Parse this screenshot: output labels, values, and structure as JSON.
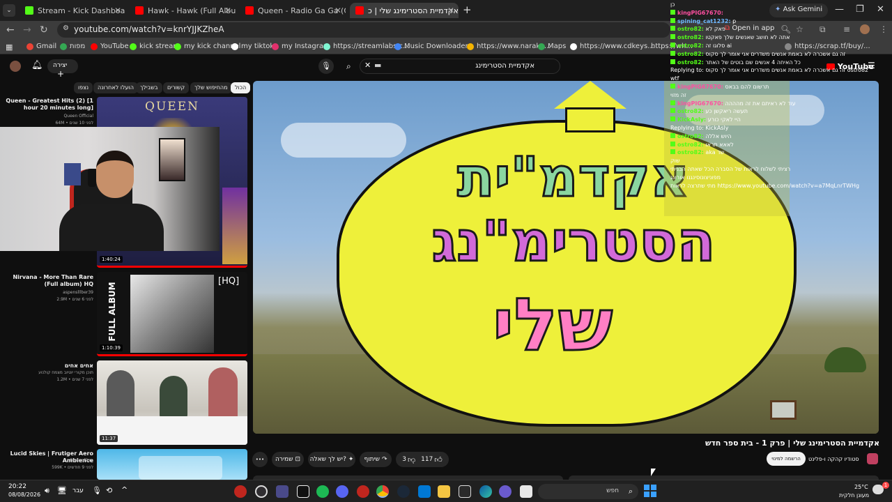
{
  "browser": {
    "tabs": [
      {
        "title": "Stream - Kick Dashboard",
        "color": "#53fc18"
      },
      {
        "title": "Hawk - Hawk (Full Album 1985)",
        "color": "#ff0000"
      },
      {
        "title": "Queen - Radio Ga Ga (Official V",
        "color": "#ff0000"
      },
      {
        "title": "אקדמיית הסטרימינג שלי | כ",
        "color": "#ff0000"
      }
    ],
    "new_tab": "+",
    "url": "youtube.com/watch?v=knrYJJKZheA",
    "ask_gemini": "Ask Gemini",
    "open_in_app": "Open in app",
    "bookmarks": [
      {
        "label": "Gmail",
        "color": "#ea4335"
      },
      {
        "label": "מפות",
        "color": "#34a853"
      },
      {
        "label": "YouTube",
        "color": "#ff0000"
      },
      {
        "label": "kick stream",
        "color": "#53fc18"
      },
      {
        "label": "my kick channel",
        "color": "#53fc18"
      },
      {
        "label": "my tiktok",
        "color": "#ffffff"
      },
      {
        "label": "my Instagram",
        "color": "#e1306c"
      },
      {
        "label": "https://streamlabs.c...",
        "color": "#80f5d2"
      },
      {
        "label": "Music Downloader...",
        "color": "#4285f4"
      },
      {
        "label": "https://www.narake...",
        "color": "#f4b400"
      },
      {
        "label": "Maps",
        "color": "#34a853"
      },
      {
        "label": "https://www.cdkeys...",
        "color": "#ffffff"
      },
      {
        "label": "https://wh...",
        "color": "#888888"
      },
      {
        "label": "https://scrap.tf/buy/...",
        "color": "#888888"
      }
    ]
  },
  "youtube": {
    "create_label": "יצירה",
    "search_query": "אקדמיית הסטרימינג",
    "logo": "YouTube",
    "chips": [
      "הכול",
      "מהחיפוש שלך",
      "קשורים",
      "בשבילך",
      "הועלו לאחרונה",
      "נצפו"
    ]
  },
  "recommendations": [
    {
      "title": "Queen - Greatest Hits (2) [1 hour 20 minutes long]",
      "channel": "Queen Official",
      "meta": "64M  •  לפני 10 שנים",
      "duration": "1:40:24",
      "thumb_text": "QUEEN"
    },
    {
      "title": "Nirvana - More Than Rare (Full album) HQ",
      "channel": "aspenslllber39",
      "meta": "2.9M  •  לפני 6 שנים",
      "duration": "1:10:39",
      "thumb_text": "FULL ALBUM",
      "thumb_badge": "[HQ]"
    },
    {
      "title": "אחים אחים",
      "channel": "תוכן מקורי יוטיוב מצמח קולנוע",
      "meta": "1.2M  •  לפני 7 שנים",
      "duration": "11:37"
    },
    {
      "title": "Lucid Skies | Frutiger Aero Ambience",
      "channel": "Dreamfibre",
      "meta": "599K  •  לפני 9 חודשים",
      "duration": ""
    }
  ],
  "chat": [
    {
      "user": "",
      "text": "כן",
      "cls": ""
    },
    {
      "user": "kingPIG67670:",
      "text": "",
      "cls": ""
    },
    {
      "user": "spining_cat1232:",
      "text": "p",
      "cls": "b"
    },
    {
      "user": "ostro82:",
      "text": "פאק לא",
      "cls": "g"
    },
    {
      "user": "ostro82:",
      "text": "אתה לא חושב שאנשים שלך פאקטו",
      "cls": "g"
    },
    {
      "user": "ostro82:",
      "text": "סלוגו זה ai",
      "cls": "g"
    },
    {
      "user": "ostro82:",
      "text": "זה גם אשכרה לא באמת אנשים משדרים אני אומר לך סקוס",
      "cls": "g"
    },
    {
      "user": "ostro82:",
      "text": "כל האיחה 4 אנשים שם בוטים של האתר",
      "cls": "g"
    },
    {
      "user": "",
      "text": "Replying to: זה גם אשכרה לא באמת אנשים משדרים אני אומר לך סקוס ostro82",
      "cls": ""
    },
    {
      "user": "",
      "text": "wtf",
      "cls": ""
    },
    {
      "user": "kingPIG67670:",
      "text": "תרשום להם בבאס",
      "cls": ""
    },
    {
      "user": "",
      "text": "זה מזוי",
      "cls": ""
    },
    {
      "user": "kingPIG67670:",
      "text": "עוד לא ראיתם את זה מהההה",
      "cls": ""
    },
    {
      "user": "ostro82:",
      "text": "תעשה ריאקשן כע",
      "cls": "g"
    },
    {
      "user": "KickAsly:",
      "text": "היי לאקי כורע",
      "cls": "g"
    },
    {
      "user": "",
      "text": "Replying to: KickAsly",
      "cls": ""
    },
    {
      "user": "ostro82:",
      "text": "היוש אללה",
      "cls": "g"
    },
    {
      "user": "ostro82:",
      "text": "לאאא תראו",
      "cls": "g"
    },
    {
      "user": "ostro82:",
      "text": "aka שד",
      "cls": "g"
    },
    {
      "user": "",
      "text": "שוק",
      "cls": ""
    },
    {
      "user": "",
      "text": "רציתי לשלוח לראות של הסברה הכל שאתה הבניתי",
      "cls": ""
    },
    {
      "user": "",
      "text": "מפוניצונוסינגנו אורונג",
      "cls": ""
    },
    {
      "user": "",
      "text": "מתי שתרצה לראות https://www.youtube.com/watch?v=a7MqLnrTWHg",
      "cls": ""
    }
  ],
  "video": {
    "title": "אקדמיית הסטרימינג שלי | פרק 1 - בית ספר חדש",
    "artwork_lines": [
      "אקדמ\"ית",
      "הסטרימ\"נג",
      "שלי"
    ],
    "channel": "סטודיו קהקה ו-פלינט",
    "subscribe": "הרשמה למינוי",
    "likes": "117",
    "dislikes": "3",
    "share": "שיתוף",
    "ask": "יש לך שאלה?",
    "save": "שמירה",
    "more": "•••"
  },
  "taskbar": {
    "time": "20:22",
    "date": "08/08/2026",
    "lang": "עבר",
    "search_placeholder": "חפש",
    "weather_temp": "25°C",
    "weather_desc": "מעונן חלקית"
  }
}
